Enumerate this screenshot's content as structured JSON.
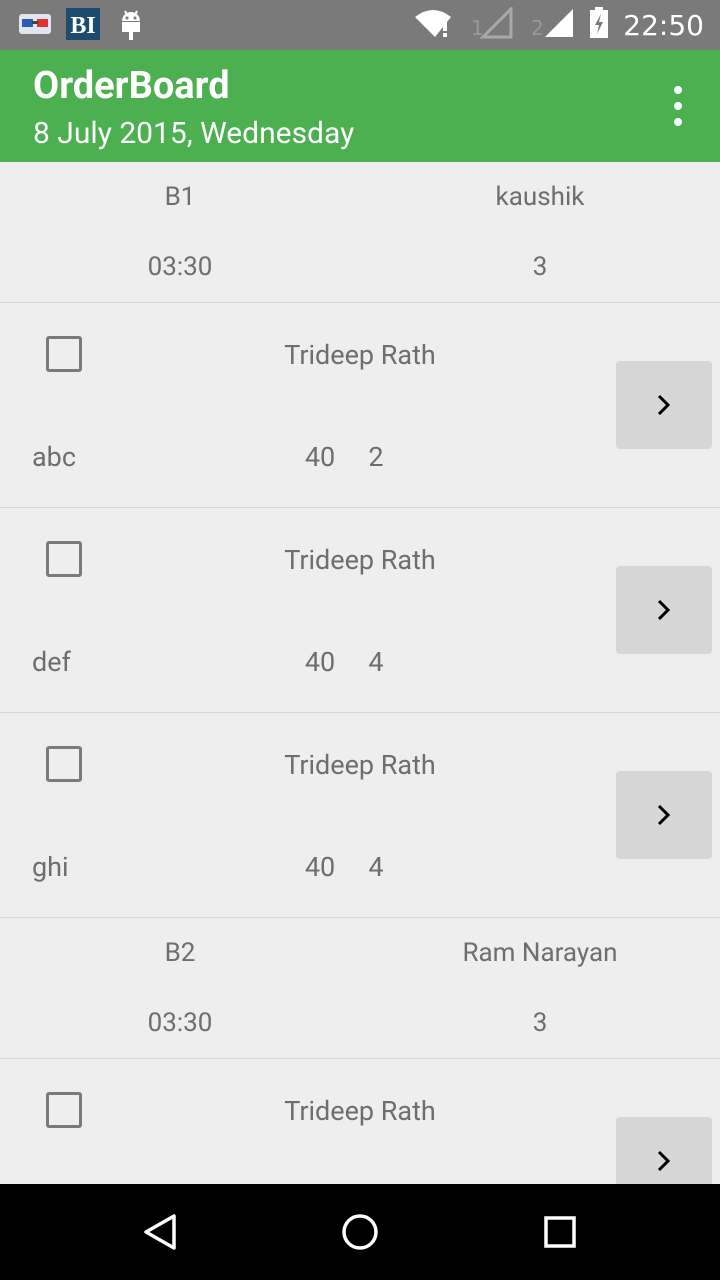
{
  "status_bar": {
    "time": "22:50",
    "icons": [
      "glasses-icon",
      "bi-icon",
      "android-icon",
      "wifi-icon",
      "signal-sim1-icon",
      "signal-sim2-icon",
      "battery-icon"
    ],
    "bi_label": "BI",
    "sim1_label": "1",
    "sim2_label": "2"
  },
  "app_bar": {
    "title": "OrderBoard",
    "subtitle": "8 July 2015, Wednesday",
    "accent_color": "#4caf50"
  },
  "groups": [
    {
      "batch": "B1",
      "name": "kaushik",
      "time": "03:30",
      "count": "3",
      "orders": [
        {
          "customer": "Trideep Rath",
          "item": "abc",
          "price": "40",
          "qty": "2",
          "checked": false
        },
        {
          "customer": "Trideep Rath",
          "item": "def",
          "price": "40",
          "qty": "4",
          "checked": false
        },
        {
          "customer": "Trideep Rath",
          "item": "ghi",
          "price": "40",
          "qty": "4",
          "checked": false
        }
      ]
    },
    {
      "batch": "B2",
      "name": "Ram Narayan",
      "time": "03:30",
      "count": "3",
      "orders": [
        {
          "customer": "Trideep Rath",
          "item": "",
          "price": "",
          "qty": "",
          "checked": false
        }
      ]
    }
  ],
  "nav_bar": {
    "buttons": [
      "back-icon",
      "home-icon",
      "recents-icon"
    ]
  }
}
